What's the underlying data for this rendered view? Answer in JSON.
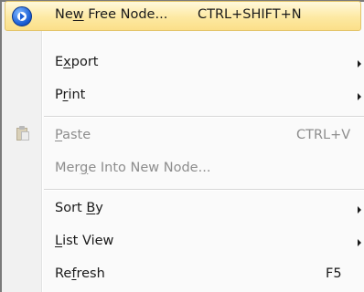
{
  "menu": {
    "items": [
      {
        "before": "Ne",
        "accel": "w",
        "after": " Free Node...",
        "shortcut": "CTRL+SHIFT+N"
      },
      {
        "before": "E",
        "accel": "x",
        "after": "port"
      },
      {
        "before": "P",
        "accel": "r",
        "after": "int"
      },
      {
        "before": "",
        "accel": "P",
        "after": "aste",
        "shortcut": "CTRL+V"
      },
      {
        "before": "Mer",
        "accel": "g",
        "after": "e Into New Node..."
      },
      {
        "before": "Sort ",
        "accel": "B",
        "after": "y"
      },
      {
        "before": "",
        "accel": "L",
        "after": "ist View"
      },
      {
        "before": "Re",
        "accel": "f",
        "after": "resh",
        "shortcut": "F5"
      }
    ]
  },
  "icons": {
    "new_free_node": "new-node-icon",
    "paste": "paste-icon",
    "submenu": "submenu-arrow-icon"
  },
  "colors": {
    "highlight_top": "#fff8dc",
    "highlight_bottom": "#fbdf89",
    "highlight_border": "#e2c369",
    "disabled_text": "#8d8d8d",
    "gutter": "#f1f1f1"
  }
}
